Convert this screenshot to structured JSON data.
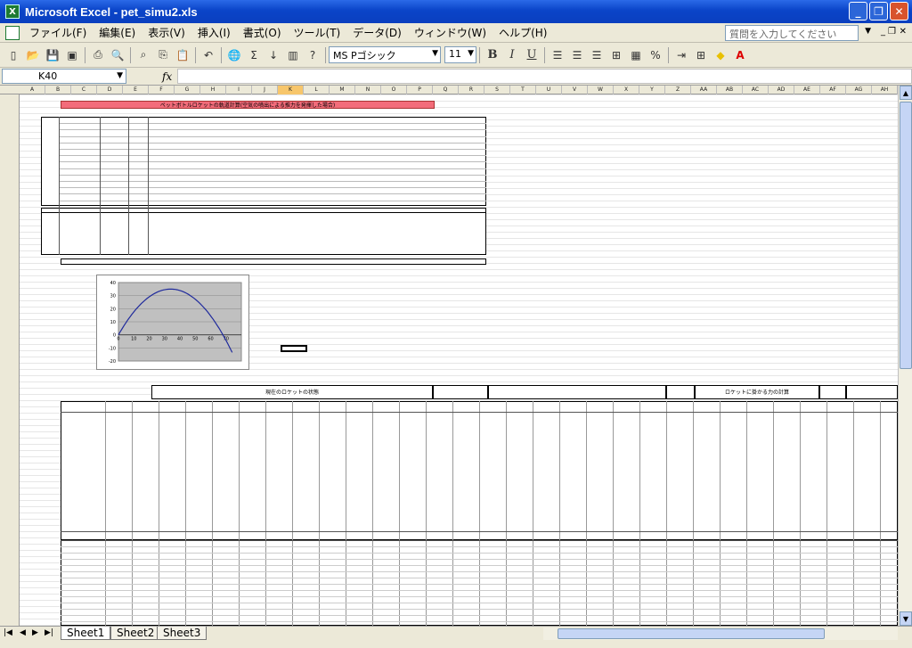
{
  "window": {
    "title": "Microsoft Excel - pet_simu2.xls"
  },
  "menu": {
    "items": [
      "ファイル(F)",
      "編集(E)",
      "表示(V)",
      "挿入(I)",
      "書式(O)",
      "ツール(T)",
      "データ(D)",
      "ウィンドウ(W)",
      "ヘルプ(H)"
    ],
    "help_placeholder": "質問を入力してください"
  },
  "toolbar": {
    "font_name": "MS Pゴシック",
    "font_size": "11",
    "sigma": "Σ",
    "zoom_label": "%"
  },
  "formula": {
    "cell_ref": "K40",
    "fx": "fx",
    "value": ""
  },
  "sheet": {
    "columns": [
      "A",
      "B",
      "C",
      "D",
      "E",
      "F",
      "G",
      "H",
      "I",
      "J",
      "K",
      "L",
      "M",
      "N",
      "O",
      "P",
      "Q",
      "R",
      "S",
      "T",
      "U",
      "V",
      "W",
      "X",
      "Y",
      "Z",
      "AA",
      "AB",
      "AC",
      "AD",
      "AE",
      "AF",
      "AG",
      "AH"
    ],
    "title_banner": "ペットボトルロケットの軌道計算(空気の噴出による推力を発揮した場合)",
    "section_header": "現在のロケットの状態",
    "force_header": "ロケットに掛かる力の計算",
    "chart": {
      "y_ticks": [
        "40",
        "30",
        "20",
        "10",
        "0",
        "-10",
        "-20"
      ],
      "x_ticks": [
        "0",
        "10",
        "20",
        "30",
        "40",
        "50",
        "60",
        "70"
      ]
    }
  },
  "tabs": [
    "Sheet1",
    "Sheet2",
    "Sheet3"
  ],
  "colors": {
    "titlebar": "#0a44c8",
    "banner": "#f36c7a",
    "curve": "#1f2a9c"
  }
}
